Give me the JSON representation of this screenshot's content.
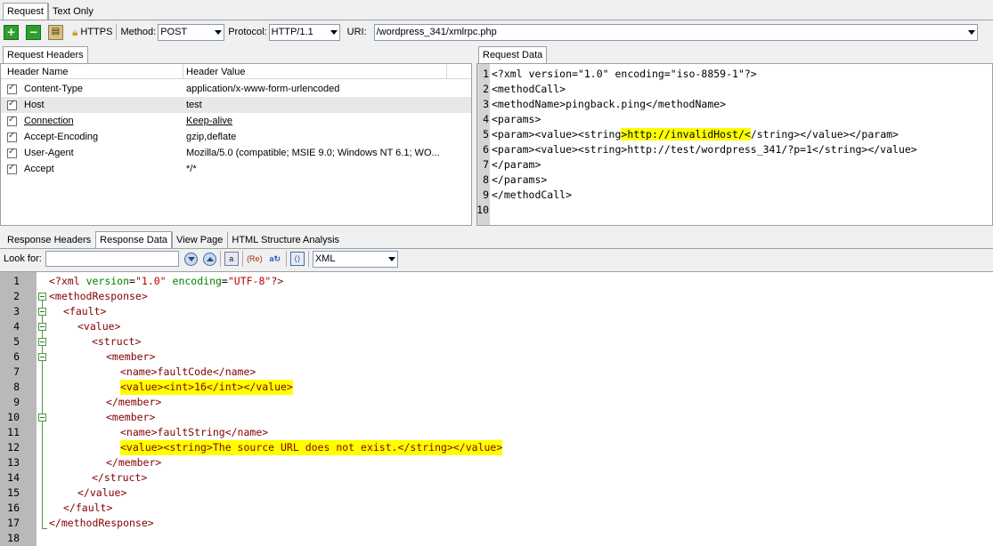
{
  "tabs_top": [
    {
      "label": "Request",
      "active": true
    },
    {
      "label": "Text Only",
      "active": false
    }
  ],
  "toolbar": {
    "https_label": "HTTPS",
    "method_label": "Method:",
    "method_value": "POST",
    "protocol_label": "Protocol:",
    "protocol_value": "HTTP/1.1",
    "uri_label": "URI:",
    "uri_value": "/wordpress_341/xmlrpc.php"
  },
  "request_headers": {
    "tab_label": "Request Headers",
    "col_name": "Header Name",
    "col_value": "Header Value",
    "rows": [
      {
        "name": "Content-Type",
        "value": "application/x-www-form-urlencoded",
        "underline": false,
        "selected": false
      },
      {
        "name": "Host",
        "value": "test",
        "underline": false,
        "selected": true
      },
      {
        "name": "Connection",
        "value": "Keep-alive",
        "underline": true,
        "selected": false
      },
      {
        "name": "Accept-Encoding",
        "value": "gzip,deflate",
        "underline": false,
        "selected": false
      },
      {
        "name": "User-Agent",
        "value": "Mozilla/5.0 (compatible; MSIE 9.0; Windows NT 6.1; WO...",
        "underline": false,
        "selected": false
      },
      {
        "name": "Accept",
        "value": "*/*",
        "underline": false,
        "selected": false
      }
    ]
  },
  "request_data": {
    "tab_label": "Request Data",
    "lines": [
      {
        "n": "1",
        "text": "<?xml version=\"1.0\" encoding=\"iso-8859-1\"?>"
      },
      {
        "n": "2",
        "text": "<methodCall>"
      },
      {
        "n": "3",
        "text": "<methodName>pingback.ping</methodName>"
      },
      {
        "n": "4",
        "text": "<params>"
      },
      {
        "n": "5",
        "pre": "<param><value><string",
        "hl": ">http://invalidHost/<",
        "post": "/string></value></param>"
      },
      {
        "n": "6",
        "text": "<param><value><string>http://test/wordpress_341/?p=1</string></value>"
      },
      {
        "n": "7",
        "text": "</param>"
      },
      {
        "n": "8",
        "text": "</params>"
      },
      {
        "n": "9",
        "text": "</methodCall>"
      },
      {
        "n": "10",
        "text": ""
      }
    ]
  },
  "tabs_bottom": [
    {
      "label": "Response Headers",
      "active": false
    },
    {
      "label": "Response Data",
      "active": true
    },
    {
      "label": "View Page",
      "active": false
    },
    {
      "label": "HTML Structure Analysis",
      "active": false
    }
  ],
  "find_bar": {
    "look_for_label": "Look for:",
    "look_for_value": "",
    "format_value": "XML"
  },
  "response_data": {
    "line_numbers": [
      "1",
      "2",
      "3",
      "4",
      "5",
      "6",
      "7",
      "8",
      "9",
      "10",
      "11",
      "12",
      "13",
      "14",
      "15",
      "16",
      "17",
      "18"
    ],
    "xml_decl": {
      "open": "<?xml",
      "attr1": "version",
      "val1": "\"1.0\"",
      "attr2": "encoding",
      "val2": "\"UTF-8\"",
      "close": "?>"
    },
    "lines": [
      {
        "indent": 0,
        "text": "<methodResponse>"
      },
      {
        "indent": 1,
        "text": "<fault>"
      },
      {
        "indent": 2,
        "text": "<value>"
      },
      {
        "indent": 3,
        "text": "<struct>"
      },
      {
        "indent": 4,
        "text": "<member>"
      },
      {
        "indent": 5,
        "text": "<name>faultCode</name>"
      },
      {
        "indent": 5,
        "text": "<value><int>16</int></value>",
        "hl": true
      },
      {
        "indent": 4,
        "text": "</member>"
      },
      {
        "indent": 4,
        "text": "<member>"
      },
      {
        "indent": 5,
        "text": "<name>faultString</name>"
      },
      {
        "indent": 5,
        "text": "<value><string>The source URL does not exist.</string></value>",
        "hl": true
      },
      {
        "indent": 4,
        "text": "</member>"
      },
      {
        "indent": 3,
        "text": "</struct>"
      },
      {
        "indent": 2,
        "text": "</value>"
      },
      {
        "indent": 1,
        "text": "</fault>"
      },
      {
        "indent": 0,
        "text": "</methodResponse>"
      }
    ]
  },
  "colors": {
    "highlight": "#ffff00",
    "tag": "#800000",
    "attr": "#008000",
    "attr_value": "#c00000",
    "gutter": "#b9b9b9"
  },
  "icons": [
    "add-icon",
    "remove-icon",
    "paste-icon",
    "lock-icon",
    "find-next-icon",
    "find-prev-icon",
    "match-case-icon",
    "regex-icon",
    "replace-icon",
    "wrap-icon"
  ]
}
